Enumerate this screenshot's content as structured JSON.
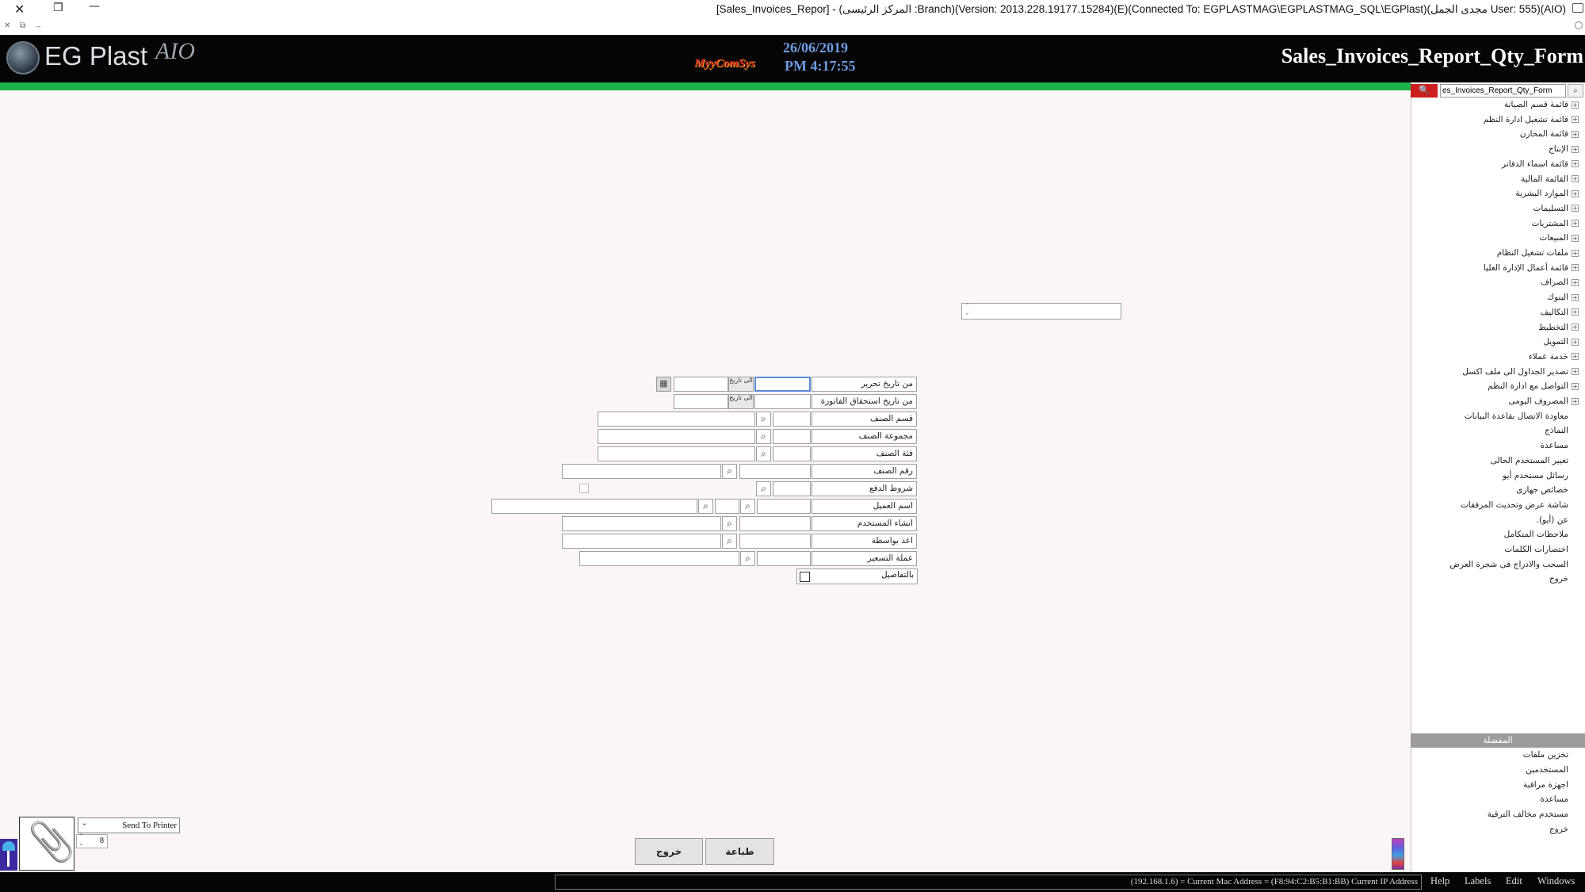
{
  "window": {
    "title": "[Sales_Invoices_Repor] - (المركز الرئيسى :Branch)(Version: 2013.228.19177.15284)(E)(Connected To: EGPLASTMAG\\EGPLASTMAG_SQL\\EGPlast)(مجدى الجمل User: 555)(AIO)",
    "close_glyph": "✕",
    "restore_glyph": "❐",
    "minimize_glyph": "—",
    "small_close": "✕",
    "small_restore": "⧉",
    "small_min": "_"
  },
  "header": {
    "logo_text": "EG Plast",
    "logo_suffix": "AIO",
    "brand": "MyyComSys",
    "date": "26/06/2019",
    "time": "PM 4:17:55",
    "form_title": "Sales_Invoices_Report_Qty_Form"
  },
  "sidebar": {
    "search_value": "es_Invoices_Report_Qty_Form",
    "search_icon": "🔍",
    "go_icon": "⌕",
    "tree": [
      {
        "label": "قائمة قسم الصيانة",
        "expandable": true
      },
      {
        "label": "قائمة تشغيل ادارة النظم",
        "expandable": true
      },
      {
        "label": "قائمة المخازن",
        "expandable": true
      },
      {
        "label": "الإنتاج",
        "expandable": true
      },
      {
        "label": "قائمة اسماء الدفاتر",
        "expandable": true
      },
      {
        "label": "القائمة المالية",
        "expandable": true
      },
      {
        "label": "الموارد البشرية",
        "expandable": true
      },
      {
        "label": "التسليمات",
        "expandable": true
      },
      {
        "label": "المشتريات",
        "expandable": true
      },
      {
        "label": "المبيعات",
        "expandable": true
      },
      {
        "label": "ملفات تشغيل النظام",
        "expandable": true
      },
      {
        "label": "قائمة أعمال الإدارة العليا",
        "expandable": true
      },
      {
        "label": "الصراف",
        "expandable": true
      },
      {
        "label": "البنوك",
        "expandable": true
      },
      {
        "label": "التكاليف",
        "expandable": true
      },
      {
        "label": "التخطيط",
        "expandable": true
      },
      {
        "label": "التمويل",
        "expandable": true
      },
      {
        "label": "خدمة عملاء",
        "expandable": true
      },
      {
        "label": "تصدير الجداول الى ملف اكسل",
        "expandable": true
      },
      {
        "label": "التواصل مع ادارة النظم",
        "expandable": true
      },
      {
        "label": "المصروف اليومى",
        "expandable": true
      },
      {
        "label": "معاودة الاتصال بقاعدة البيانات",
        "expandable": false
      },
      {
        "label": "النماذج",
        "expandable": false
      },
      {
        "label": "مساعدة",
        "expandable": false
      },
      {
        "label": "تغيير المستخدم الحالى",
        "expandable": false
      },
      {
        "label": "رسائل مستخدم أيو",
        "expandable": false
      },
      {
        "label": "خصائص جهازى",
        "expandable": false
      },
      {
        "label": "شاشة عرض وتحديث المرفقات",
        "expandable": false
      },
      {
        "label": "عن (أيو).",
        "expandable": false
      },
      {
        "label": "ملاحظات المتكامل",
        "expandable": false
      },
      {
        "label": "اختصارات الكلمات",
        "expandable": false
      },
      {
        "label": "السحب والادراج فى شجرة العرض",
        "expandable": false
      },
      {
        "label": "خروج",
        "expandable": false
      }
    ],
    "section_title": "المفضلة",
    "favorites": [
      {
        "label": "تخزين ملفات"
      },
      {
        "label": "المستخدمين"
      },
      {
        "label": "اجهزة مراقبة"
      },
      {
        "label": "مساعدة"
      },
      {
        "label": "مستخدم مخالف الترقية"
      },
      {
        "label": "خروج"
      }
    ]
  },
  "form": {
    "from_invoice_date": "من تاريخ تحرير",
    "from_due_date": "من تاريخ استحقاق الفاتورة",
    "item_section": "قسم الصنف",
    "item_group": "مجموعة الصنف",
    "item_category": "فئة الصنف",
    "item_number": "رقم الصنف",
    "payment_terms": "شروط الدفع",
    "customer_name": "اسم العميل",
    "created_by_user": "انشاء المستخدم",
    "prepared_by": "اعد بواسطة",
    "pricing_currency": "عملة التسعير",
    "with_details": "بالتفاصيل",
    "to_date_btn": "الى تاريخ",
    "lookup_icon": "⌕",
    "calendar_icon": "▦",
    "spinner_up": "⌃",
    "spinner_down": "⌄"
  },
  "bottom": {
    "send_to_printer": "Send To Printer",
    "copies": "8",
    "print_button": "طباعة",
    "exit_button": "خروج",
    "attach_icon": "📎",
    "dropdown_arrow": "⌄"
  },
  "statusbar": {
    "network_info": "(192.168.1.6) = Current Mac Address = (F8:94:C2:B5:B1:BB) Current IP Address",
    "menu": [
      "Help",
      "Labels",
      "Edit",
      "Windows"
    ]
  }
}
